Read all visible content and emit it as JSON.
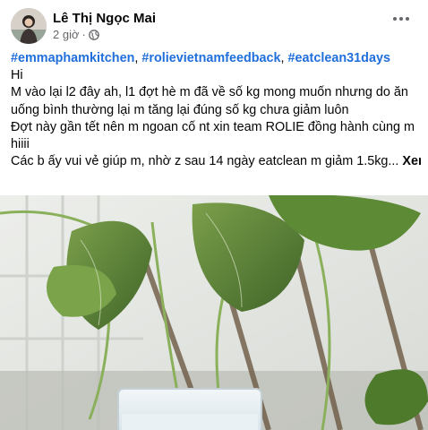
{
  "post": {
    "author": "Lê Thị Ngọc Mai",
    "time": "2 giờ",
    "privacy_icon": "globe-icon",
    "more_icon": "more-horizontal-icon",
    "hashtags": [
      "#emmaphamkitchen",
      "#rolievietnamfeedback",
      "#eatclean31days"
    ],
    "hashtag_separator": ", ",
    "lines": [
      "Hi",
      "M vào lại l2 đây ah, l1 đợt hè m đã về số kg mong muốn nhưng do ăn",
      "uống bình thường lại m tăng lại đúng số kg chưa giảm luôn",
      "Đợt này gần tết nên m ngoan cố nt xin team ROLIE đồng hành cùng m",
      "hiiii",
      "Các b ấy vui vẻ giúp m, nhờ z sau 14 ngày eatclean m giảm 1.5kg..."
    ],
    "see_more": "Xem thêm",
    "colors": {
      "hashtag": "#216fdb",
      "meta": "#65676b",
      "text": "#050505"
    }
  }
}
